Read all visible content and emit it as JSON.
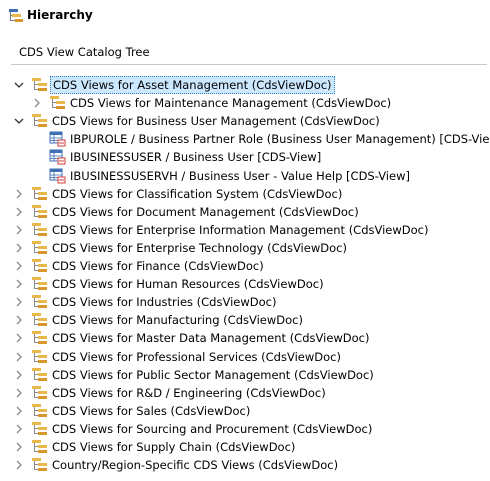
{
  "window": {
    "title": "Hierarchy",
    "title_icon": "hierarchy-icon"
  },
  "selector": {
    "value": "CDS View Catalog Tree"
  },
  "tree": {
    "rows": [
      {
        "level": 0,
        "state": "expanded",
        "icon": "folder-stack-icon",
        "label": "CDS Views for Asset Management (CdsViewDoc)",
        "selected": true
      },
      {
        "level": 1,
        "state": "collapsed",
        "icon": "folder-stack-icon",
        "label": "CDS Views for Maintenance Management (CdsViewDoc)",
        "selected": false
      },
      {
        "level": 0,
        "state": "expanded",
        "icon": "folder-stack-icon",
        "label": "CDS Views for Business User Management (CdsViewDoc)",
        "selected": false
      },
      {
        "level": 1,
        "state": "leaf",
        "icon": "cds-view-icon",
        "label": "IBPUROLE / Business Partner Role (Business User Management) [CDS-View]",
        "selected": false
      },
      {
        "level": 1,
        "state": "leaf",
        "icon": "cds-view-icon",
        "label": "IBUSINESSUSER / Business User [CDS-View]",
        "selected": false
      },
      {
        "level": 1,
        "state": "leaf",
        "icon": "cds-view-icon",
        "label": "IBUSINESSUSERVH / Business User - Value Help [CDS-View]",
        "selected": false
      },
      {
        "level": 0,
        "state": "collapsed",
        "icon": "folder-stack-icon",
        "label": "CDS Views for Classification System (CdsViewDoc)",
        "selected": false
      },
      {
        "level": 0,
        "state": "collapsed",
        "icon": "folder-stack-icon",
        "label": "CDS Views for Document Management (CdsViewDoc)",
        "selected": false
      },
      {
        "level": 0,
        "state": "collapsed",
        "icon": "folder-stack-icon",
        "label": "CDS Views for Enterprise Information Management (CdsViewDoc)",
        "selected": false
      },
      {
        "level": 0,
        "state": "collapsed",
        "icon": "folder-stack-icon",
        "label": "CDS Views for Enterprise Technology (CdsViewDoc)",
        "selected": false
      },
      {
        "level": 0,
        "state": "collapsed",
        "icon": "folder-stack-icon",
        "label": "CDS Views for Finance (CdsViewDoc)",
        "selected": false
      },
      {
        "level": 0,
        "state": "collapsed",
        "icon": "folder-stack-icon",
        "label": "CDS Views for Human Resources (CdsViewDoc)",
        "selected": false
      },
      {
        "level": 0,
        "state": "collapsed",
        "icon": "folder-stack-icon",
        "label": "CDS Views for Industries (CdsViewDoc)",
        "selected": false
      },
      {
        "level": 0,
        "state": "collapsed",
        "icon": "folder-stack-icon",
        "label": "CDS Views for Manufacturing (CdsViewDoc)",
        "selected": false
      },
      {
        "level": 0,
        "state": "collapsed",
        "icon": "folder-stack-icon",
        "label": "CDS Views for Master Data Management (CdsViewDoc)",
        "selected": false
      },
      {
        "level": 0,
        "state": "collapsed",
        "icon": "folder-stack-icon",
        "label": "CDS Views for Professional Services (CdsViewDoc)",
        "selected": false
      },
      {
        "level": 0,
        "state": "collapsed",
        "icon": "folder-stack-icon",
        "label": "CDS Views for Public Sector Management (CdsViewDoc)",
        "selected": false
      },
      {
        "level": 0,
        "state": "collapsed",
        "icon": "folder-stack-icon",
        "label": "CDS Views for R&D / Engineering (CdsViewDoc)",
        "selected": false
      },
      {
        "level": 0,
        "state": "collapsed",
        "icon": "folder-stack-icon",
        "label": "CDS Views for Sales (CdsViewDoc)",
        "selected": false
      },
      {
        "level": 0,
        "state": "collapsed",
        "icon": "folder-stack-icon",
        "label": "CDS Views for Sourcing and Procurement (CdsViewDoc)",
        "selected": false
      },
      {
        "level": 0,
        "state": "collapsed",
        "icon": "folder-stack-icon",
        "label": "CDS Views for Supply Chain (CdsViewDoc)",
        "selected": false
      },
      {
        "level": 0,
        "state": "collapsed",
        "icon": "folder-stack-icon",
        "label": "Country/Region-Specific CDS Views (CdsViewDoc)",
        "selected": false
      }
    ]
  },
  "colors": {
    "selection_bg": "#cce8ff",
    "folder_yellow": "#e8b84a",
    "folder_orange": "#d9962a",
    "icon_blue": "#3f6fb5",
    "icon_red": "#d23b3b"
  }
}
